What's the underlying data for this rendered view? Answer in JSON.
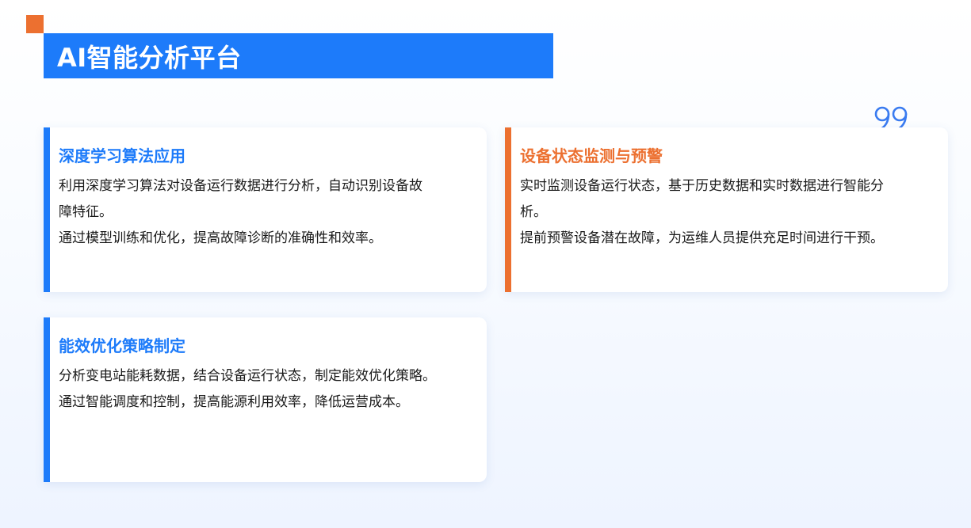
{
  "header": {
    "title": "AI智能分析平台"
  },
  "colors": {
    "primary_blue": "#1d7bfa",
    "accent_orange": "#ec7030"
  },
  "decorations": {
    "quote_icon": "quote-icon"
  },
  "cards": [
    {
      "title": "深度学习算法应用",
      "lines": [
        "利用深度学习算法对设备运行数据进行分析，自动识别设备故",
        "障特征。",
        "通过模型训练和优化，提高故障诊断的准确性和效率。"
      ]
    },
    {
      "title": "设备状态监测与预警",
      "lines": [
        "实时监测设备运行状态，基于历史数据和实时数据进行智能分",
        "析。",
        "提前预警设备潜在故障，为运维人员提供充足时间进行干预。"
      ]
    },
    {
      "title": "能效优化策略制定",
      "lines": [
        "分析变电站能耗数据，结合设备运行状态，制定能效优化策略。",
        "通过智能调度和控制，提高能源利用效率，降低运营成本。"
      ]
    }
  ]
}
